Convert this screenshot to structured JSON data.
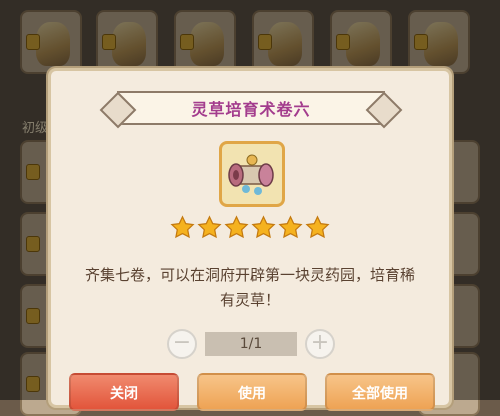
{
  "background": {
    "section_label": "初级"
  },
  "dialog": {
    "title": "灵草培育术卷六",
    "item_icon": "scroll-icon",
    "stars": 6,
    "description_line1": "齐集七卷，可以在洞府开辟第一块灵药园，培育稀",
    "description_line2": "有灵草！",
    "quantity": "1/1",
    "buttons": {
      "close": "关闭",
      "use": "使用",
      "use_all": "全部使用"
    }
  },
  "colors": {
    "title": "#a33c8d",
    "close_button": "#e2553b",
    "use_button": "#eea354",
    "star": "#f5b21f"
  }
}
